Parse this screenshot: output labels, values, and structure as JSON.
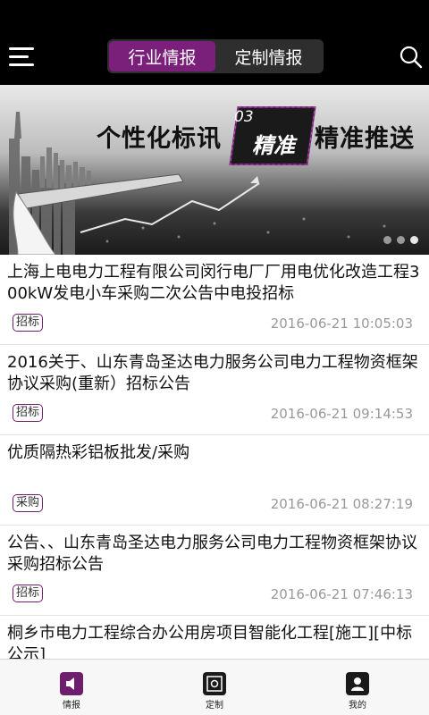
{
  "header": {
    "tabs": [
      {
        "label": "行业情报",
        "active": true
      },
      {
        "label": "定制情报",
        "active": false
      }
    ]
  },
  "banner": {
    "text_left": "个性化标讯",
    "badge_number": "03",
    "badge_word": "精准",
    "text_right": "精准推送",
    "slide_count": 3,
    "active_slide": 3
  },
  "items": [
    {
      "title": "上海上电电力工程有限公司闵行电厂厂用电优化改造工程300kW发电小车采购二次公告中电投招标",
      "tag": "招标",
      "date": "2016-06-21 10:05:03"
    },
    {
      "title": "2016关于、山东青岛圣达电力服务公司电力工程物资框架协议采购(重新）招标公告",
      "tag": "招标",
      "date": "2016-06-21 09:14:53"
    },
    {
      "title": "优质隔热彩铝板批发/采购",
      "tag": "采购",
      "date": "2016-06-21 08:27:19"
    },
    {
      "title": "公告、、山东青岛圣达电力服务公司电力工程物资框架协议采购招标公告",
      "tag": "招标",
      "date": "2016-06-21 07:46:13"
    },
    {
      "title": "桐乡市电力工程综合办公用房项目智能化工程[施工][中标公示]",
      "tag": "",
      "date": ""
    }
  ],
  "tabbar": [
    {
      "label": "情报",
      "icon": "speaker-icon",
      "active": true
    },
    {
      "label": "定制",
      "icon": "target-icon",
      "active": false
    },
    {
      "label": "我的",
      "icon": "person-icon",
      "active": false
    }
  ],
  "colors": {
    "accent": "#7a1f7a",
    "topbar": "#000000"
  }
}
